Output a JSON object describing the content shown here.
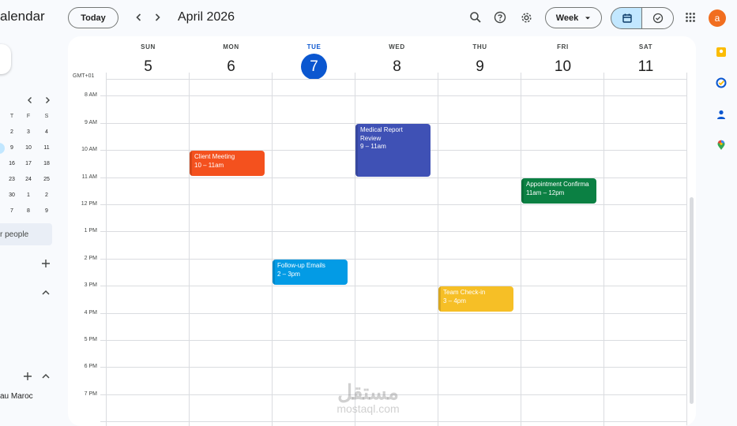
{
  "header": {
    "app_title": "alendar",
    "today_label": "Today",
    "period_label": "April 2026",
    "view_label": "Week",
    "avatar_initial": "a",
    "icons": [
      "search-icon",
      "help-icon",
      "settings-icon",
      "calendar-view-icon",
      "tasks-view-icon",
      "apps-grid-icon"
    ]
  },
  "sidebar": {
    "mini_calendar": {
      "weekday_headers": [
        "T",
        "F",
        "S"
      ],
      "rows": [
        [
          "2",
          "3",
          "4"
        ],
        [
          "9",
          "10",
          "11"
        ],
        [
          "16",
          "17",
          "18"
        ],
        [
          "23",
          "24",
          "25"
        ],
        [
          "30",
          "1",
          "2"
        ],
        [
          "7",
          "8",
          "9"
        ]
      ]
    },
    "search_people": "r people",
    "calendar_entry": "au Maroc"
  },
  "week": {
    "timezone": "GMT+01",
    "days": [
      {
        "dow": "SUN",
        "date": "5"
      },
      {
        "dow": "MON",
        "date": "6"
      },
      {
        "dow": "TUE",
        "date": "7",
        "today": true
      },
      {
        "dow": "WED",
        "date": "8"
      },
      {
        "dow": "THU",
        "date": "9"
      },
      {
        "dow": "FRI",
        "date": "10"
      },
      {
        "dow": "SAT",
        "date": "11"
      }
    ],
    "hours": [
      "8 AM",
      "9 AM",
      "10 AM",
      "11 AM",
      "12 PM",
      "1 PM",
      "2 PM",
      "3 PM",
      "4 PM",
      "5 PM",
      "6 PM",
      "7 PM"
    ]
  },
  "events": [
    {
      "title": "Client Meeting",
      "time": "10 – 11am",
      "day": 1,
      "start": 10,
      "end": 11,
      "color": "#f4511e"
    },
    {
      "title": "Medical Report",
      "title2": "Review",
      "time": "9 – 11am",
      "day": 3,
      "start": 9,
      "end": 11,
      "color": "#3f51b5"
    },
    {
      "title": "Appointment Confirma",
      "time": "11am – 12pm",
      "day": 5,
      "start": 11,
      "end": 12,
      "color": "#0b8043"
    },
    {
      "title": "Follow-up Emails",
      "time": "2 – 3pm",
      "day": 2,
      "start": 14,
      "end": 15,
      "color": "#039be5"
    },
    {
      "title": "Team Check-in",
      "time": "3 – 4pm",
      "day": 4,
      "start": 15,
      "end": 16,
      "color": "#f6bf26"
    }
  ],
  "rail": {
    "icons": [
      "keep-icon",
      "tasks-icon",
      "contacts-icon",
      "maps-icon"
    ],
    "colors": [
      "#fbbc04",
      "#0b57d0",
      "#0b57d0",
      "#34a853"
    ]
  },
  "watermark": {
    "arabic": "مستقل",
    "latin": "mostaql.com"
  }
}
